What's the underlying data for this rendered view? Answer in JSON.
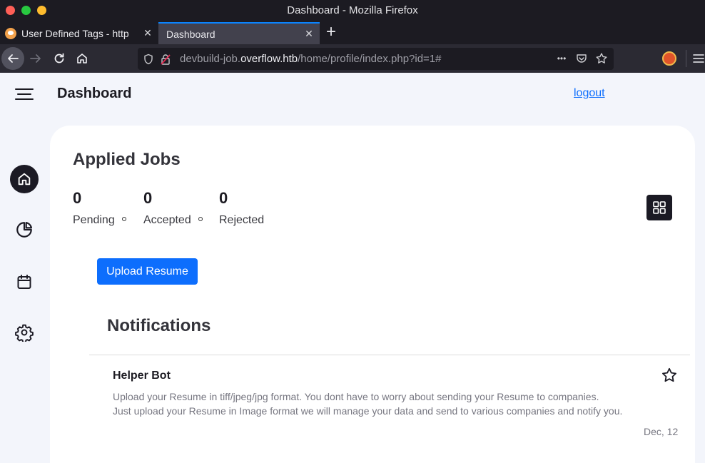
{
  "window": {
    "title": "Dashboard - Mozilla Firefox"
  },
  "tabs": [
    {
      "label": "User Defined Tags - http",
      "close": "✕"
    },
    {
      "label": "Dashboard",
      "close": "✕"
    }
  ],
  "new_tab_label": "+",
  "urlbar": {
    "prefix": "devbuild-job.",
    "host": "overflow.htb",
    "path": "/home/profile/index.php?id=1#",
    "more": "•••"
  },
  "page": {
    "title": "Dashboard",
    "logout": "logout"
  },
  "applied_jobs": {
    "title": "Applied Jobs",
    "stats": [
      {
        "value": "0",
        "label": "Pending"
      },
      {
        "value": "0",
        "label": "Accepted"
      },
      {
        "value": "0",
        "label": "Rejected"
      }
    ]
  },
  "upload_button": "Upload Resume",
  "notifications": {
    "title": "Notifications",
    "items": [
      {
        "sender": "Helper Bot",
        "line1": "Upload your Resume in tiff/jpeg/jpg format. You dont have to worry about sending your Resume to companies.",
        "line2": "Just upload your Resume in Image format we will manage your data and send to various companies and notify you.",
        "date": "Dec, 12"
      }
    ]
  },
  "colors": {
    "accent": "#0d6efd",
    "dark": "#1b1a24",
    "page_bg": "#f3f5fb"
  }
}
